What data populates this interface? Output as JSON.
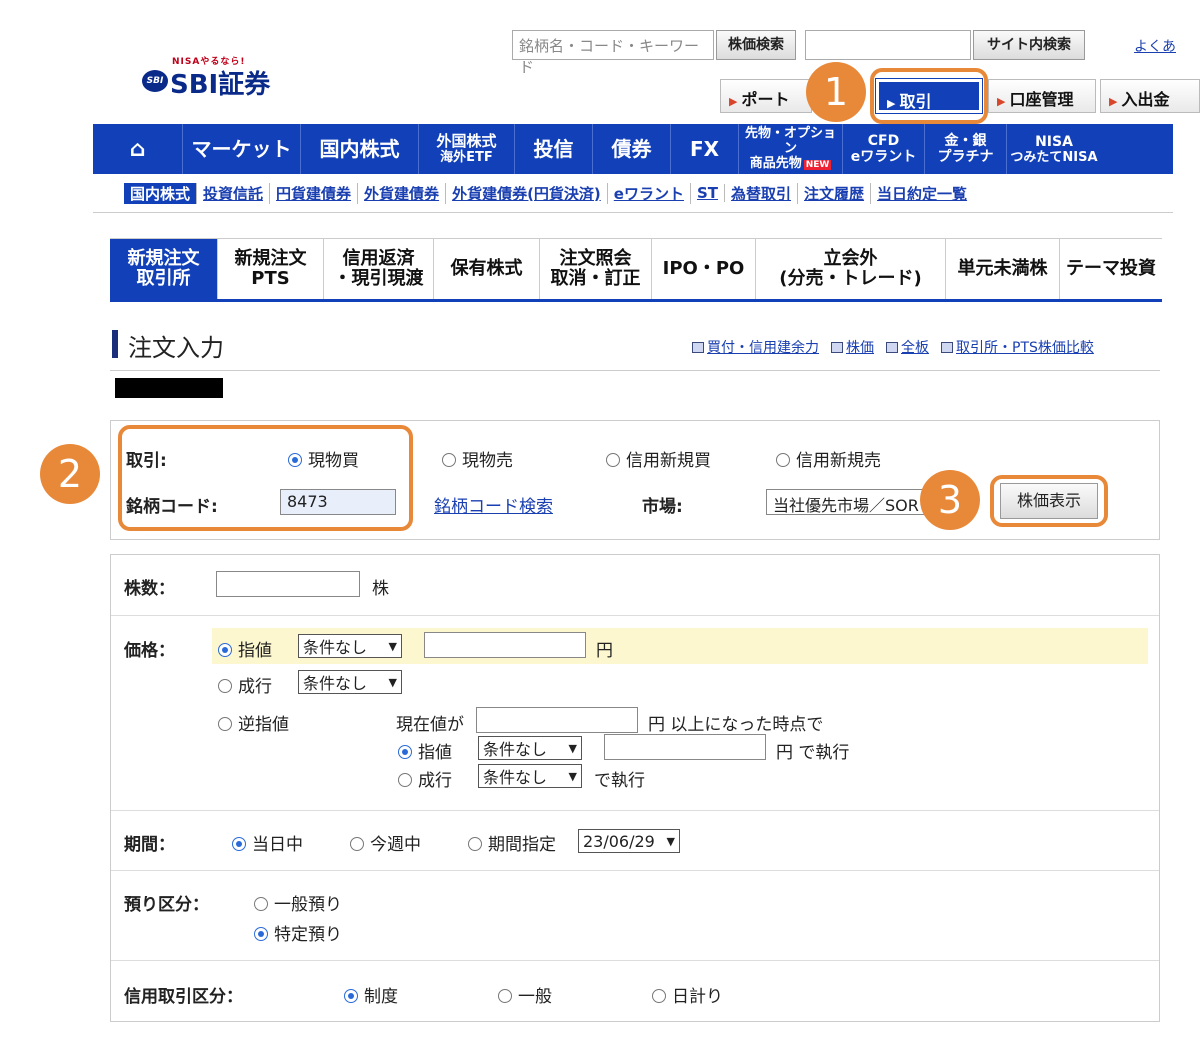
{
  "header": {
    "logo_top": "NISAやるなら!",
    "logo_badge": "SBI",
    "logo_text": "SBI証券",
    "search_placeholder": "銘柄名・コード・キーワード",
    "stock_search_button": "株価検索",
    "site_search_button": "サイト内検索",
    "top_link": "よくあ",
    "tabs": [
      {
        "label": "ポート"
      },
      {
        "label": "取引"
      },
      {
        "label": "口座管理"
      },
      {
        "label": "入出金"
      }
    ]
  },
  "callouts": [
    "1",
    "2",
    "3"
  ],
  "nav": [
    {
      "l1": "マーケット"
    },
    {
      "l1": "国内株式"
    },
    {
      "s1": "外国株式",
      "s2": "海外ETF"
    },
    {
      "l1": "投信"
    },
    {
      "l1": "債券"
    },
    {
      "l1": "FX"
    },
    {
      "s1": "先物・オプション",
      "s2": "商品先物",
      "badge": "NEW"
    },
    {
      "s1": "CFD",
      "s2": "eワラント"
    },
    {
      "s1": "金・銀",
      "s2": "プラチナ"
    },
    {
      "s1": "NISA",
      "s2": "つみたてNISA"
    }
  ],
  "subnav": [
    "国内株式",
    "投資信託",
    "円貨建債券",
    "外貨建債券",
    "外貨建債券(円貨決済)",
    "eワラント",
    "ST",
    "為替取引",
    "注文履歴",
    "当日約定一覧"
  ],
  "trade_tabs": [
    {
      "l1": "新規注文",
      "l2": "取引所"
    },
    {
      "l1": "新規注文",
      "l2": "PTS"
    },
    {
      "l1": "信用返済",
      "l2": "・現引現渡"
    },
    {
      "l1": "保有株式",
      "l2": ""
    },
    {
      "l1": "注文照会",
      "l2": "取消・訂正"
    },
    {
      "l1": "IPO・PO",
      "l2": ""
    },
    {
      "l1": "立会外",
      "l2": "(分売・トレード)"
    },
    {
      "l1": "単元未満株",
      "l2": ""
    },
    {
      "l1": "テーマ投資",
      "l2": ""
    }
  ],
  "section": {
    "title": "注文入力",
    "links": [
      "買付・信用建余力",
      "株価",
      "全板",
      "取引所・PTS株価比較"
    ]
  },
  "order_head": {
    "trade_label": "取引:",
    "trade_options": [
      "現物買",
      "現物売",
      "信用新規買",
      "信用新規売"
    ],
    "code_label": "銘柄コード:",
    "code_value": "8473",
    "code_search_link": "銘柄コード検索",
    "market_label": "市場:",
    "market_value": "当社優先市場／SOR",
    "price_display_button": "株価表示"
  },
  "form": {
    "shares_label": "株数：",
    "shares_unit": "株",
    "price_label": "価格：",
    "limit": "指値",
    "market": "成行",
    "stop": "逆指値",
    "cond_none": "条件なし",
    "yen": "円",
    "current_price_if": "現在値が",
    "above_text": "円 以上になった時点で",
    "exec_with": "円 で執行",
    "exec_suffix": "で執行",
    "period_label": "期間：",
    "period_options": [
      "当日中",
      "今週中",
      "期間指定"
    ],
    "period_date": "23/06/29",
    "deposit_label": "預り区分：",
    "deposit_options": [
      "一般預り",
      "特定預り"
    ],
    "credit_label": "信用取引区分：",
    "credit_options": [
      "制度",
      "一般",
      "日計り"
    ]
  }
}
